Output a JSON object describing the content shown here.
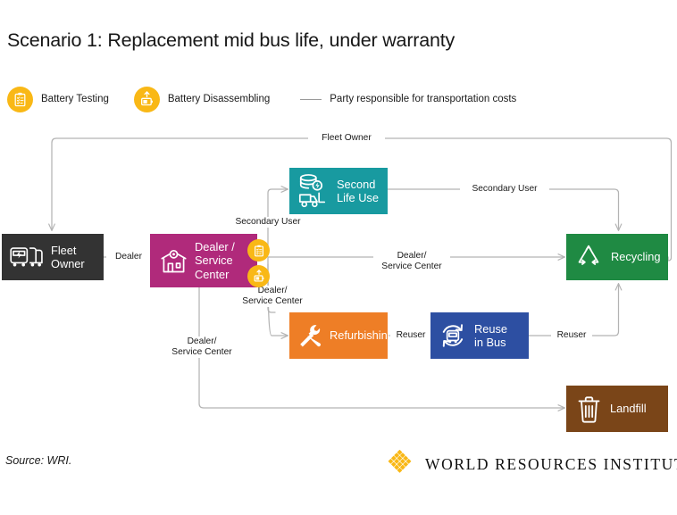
{
  "title": "Scenario 1: Replacement mid bus life, under warranty",
  "colors": {
    "amber": "#F9B816",
    "fleet_owner": "#333333",
    "dealer": "#B02A7B",
    "second_life": "#189AA0",
    "recycling": "#1F8A43",
    "refurbishing": "#EE7E26",
    "reuse_in_bus": "#2D4FA2",
    "landfill": "#7A4518",
    "edge": "#B3B3B3"
  },
  "legend": {
    "items": [
      {
        "icon": "clipboard-checklist-icon",
        "label": "Battery Testing"
      },
      {
        "icon": "battery-arrow-up-icon",
        "label": "Battery Disassembling"
      }
    ],
    "line_note": "Party responsible for transportation costs"
  },
  "nodes": {
    "fleet_owner": {
      "label": "Fleet\nOwner",
      "icon": "bus-fleet-icon"
    },
    "dealer": {
      "label": "Dealer /\nService\nCenter",
      "icon": "service-center-building-icon",
      "badges": [
        "clipboard-checklist-icon",
        "battery-arrow-up-icon"
      ]
    },
    "second_life": {
      "label": "Second\nLife Use",
      "icon": "battery-stack-forklift-icon"
    },
    "recycling": {
      "label": "Recycling",
      "icon": "recycling-arrows-icon"
    },
    "refurbishing": {
      "label": "Refurbishing",
      "icon": "wrench-screwdriver-icon"
    },
    "reuse_in_bus": {
      "label": "Reuse\nin Bus",
      "icon": "bus-cycle-icon"
    },
    "landfill": {
      "label": "Landfill",
      "icon": "trash-can-icon"
    }
  },
  "edge_labels": {
    "fleet_owner_return": "Fleet Owner",
    "dealer": "Dealer",
    "secondary_user_up": "Secondary User",
    "secondary_user_right": "Secondary User",
    "dealer_service_recycling": "Dealer/\nService Center",
    "dealer_service_refurb": "Dealer/\nService Center",
    "dealer_service_landfill": "Dealer/\nService Center",
    "reuser_mid": "Reuser",
    "reuser_right": "Reuser"
  },
  "footer": {
    "source_prefix": "Source:",
    "source_value": " WRI.",
    "source_full": "Source: WRI.",
    "wordmark": "WORLD RESOURCES INSTITUTE",
    "logo": "wri-diamond-logo"
  },
  "chart_data": {
    "type": "diagram",
    "title": "Scenario 1: Replacement mid bus life, under warranty",
    "nodes": [
      "Fleet Owner",
      "Dealer / Service Center",
      "Second Life Use",
      "Recycling",
      "Refurbishing",
      "Reuse in Bus",
      "Landfill"
    ],
    "edges": [
      {
        "from": "Fleet Owner",
        "to": "Dealer / Service Center",
        "label": "Dealer"
      },
      {
        "from": "Dealer / Service Center",
        "to": "Second Life Use",
        "label": "Secondary User"
      },
      {
        "from": "Dealer / Service Center",
        "to": "Recycling",
        "label": "Dealer/Service Center"
      },
      {
        "from": "Dealer / Service Center",
        "to": "Refurbishing",
        "label": "Dealer/Service Center"
      },
      {
        "from": "Dealer / Service Center",
        "to": "Landfill",
        "label": "Dealer/Service Center"
      },
      {
        "from": "Second Life Use",
        "to": "Recycling",
        "label": "Secondary User"
      },
      {
        "from": "Refurbishing",
        "to": "Reuse in Bus",
        "label": "Reuser"
      },
      {
        "from": "Reuse in Bus",
        "to": "Recycling",
        "label": "Reuser"
      },
      {
        "from": "Recycling",
        "to": "Fleet Owner",
        "label": "Fleet Owner"
      }
    ]
  }
}
